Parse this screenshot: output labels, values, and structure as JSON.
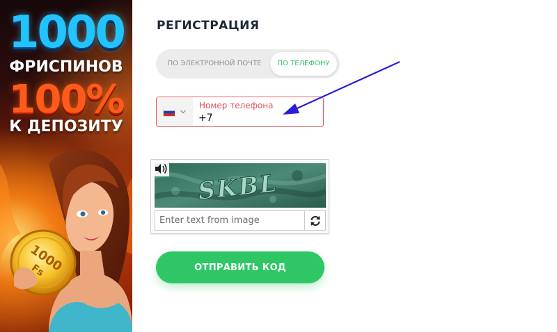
{
  "banner": {
    "line1": "1000",
    "line2": "ФРИСПИНОВ",
    "line3": "100%",
    "line4": "К ДЕПОЗИТУ",
    "coin_amount": "1000",
    "coin_unit": "Fs"
  },
  "registration": {
    "title": "РЕГИСТРАЦИЯ",
    "tabs": [
      {
        "label": "ПО ЭЛЕКТРОННОЙ ПОЧТЕ",
        "active": false
      },
      {
        "label": "ПО ТЕЛЕФОНУ",
        "active": true
      }
    ],
    "phone": {
      "country_flag": "ru-flag-icon",
      "label": "Номер телефона",
      "value": "+7"
    },
    "captcha": {
      "image_text": "SKBL",
      "input_placeholder": "Enter text from image",
      "audio_icon": "speaker-icon",
      "refresh_icon": "refresh-icon"
    },
    "submit_label": "ОТПРАВИТЬ КОД"
  },
  "annotation": {
    "arrow_color": "#2a1fd6"
  },
  "colors": {
    "accent_green": "#2fc766",
    "error_red": "#e0505c",
    "tab_active_text": "#32c364",
    "title_text": "#1f2a35"
  }
}
